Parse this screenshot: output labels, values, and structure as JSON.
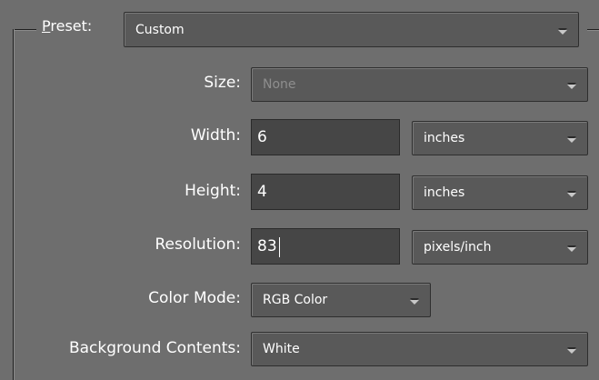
{
  "preset": {
    "label_underlined": "P",
    "label_rest": "reset:",
    "value": "Custom"
  },
  "size": {
    "label": "Size:",
    "value": "None"
  },
  "width": {
    "label": "Width:",
    "value": "6",
    "unit": "inches"
  },
  "height": {
    "label": "Height:",
    "value": "4",
    "unit": "inches"
  },
  "resolution": {
    "label": "Resolution:",
    "value": "83",
    "unit": "pixels/inch"
  },
  "color_mode": {
    "label": "Color Mode:",
    "value": "RGB Color"
  },
  "background": {
    "label": "Background Contents:",
    "value": "White"
  },
  "colors": {
    "panel_bg": "#6e6e6e",
    "field_bg": "#464646",
    "combo_bg": "#595959",
    "text": "#ffffff",
    "disabled_text": "#8e8e8e"
  },
  "icons": [
    "chevron-down-icon"
  ]
}
